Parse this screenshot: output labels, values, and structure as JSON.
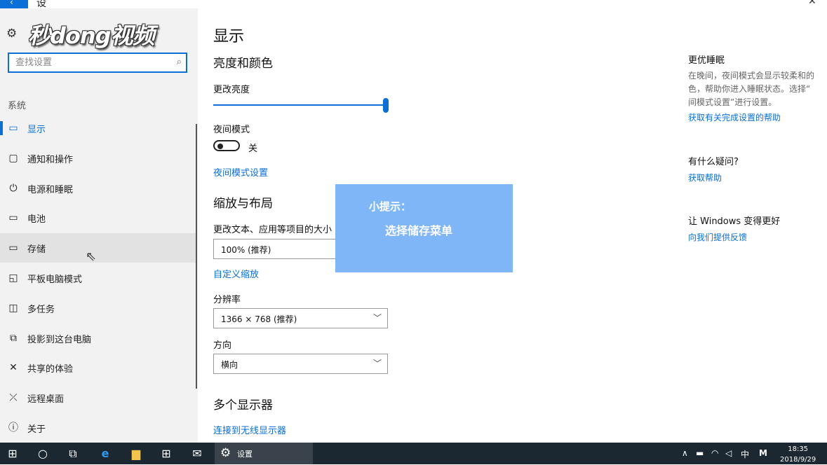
{
  "window": {
    "title_fragment": "设",
    "back_glyph": "‹",
    "close_glyph": "✕"
  },
  "sidebar": {
    "logo_text": "秒dong视频",
    "search_placeholder": "查找设置",
    "section_label": "系统",
    "items": [
      {
        "label": "显示",
        "icon": "monitor-icon",
        "glyph": "▭",
        "active": true
      },
      {
        "label": "通知和操作",
        "icon": "notification-icon",
        "glyph": "▢"
      },
      {
        "label": "电源和睡眠",
        "icon": "power-icon",
        "glyph": "⏻"
      },
      {
        "label": "电池",
        "icon": "battery-icon",
        "glyph": "▭"
      },
      {
        "label": "存储",
        "icon": "storage-icon",
        "glyph": "▭",
        "hover": true
      },
      {
        "label": "平板电脑模式",
        "icon": "tablet-icon",
        "glyph": "◱"
      },
      {
        "label": "多任务",
        "icon": "multitask-icon",
        "glyph": "◫"
      },
      {
        "label": "投影到这台电脑",
        "icon": "project-icon",
        "glyph": "⧉"
      },
      {
        "label": "共享的体验",
        "icon": "shared-icon",
        "glyph": "✕"
      },
      {
        "label": "远程桌面",
        "icon": "remote-icon",
        "glyph": "⤫"
      },
      {
        "label": "关于",
        "icon": "info-icon",
        "glyph": "ⓘ"
      }
    ]
  },
  "main": {
    "title": "显示",
    "brightness_section": "亮度和颜色",
    "brightness_label": "更改亮度",
    "brightness_value": 1.0,
    "night_mode_label": "夜间模式",
    "night_mode_state": "关",
    "night_mode_link": "夜间模式设置",
    "scale_section": "缩放与布局",
    "scale_label": "更改文本、应用等项目的大小",
    "scale_value": "100% (推荐)",
    "custom_scale_link": "自定义缩放",
    "resolution_label": "分辨率",
    "resolution_value": "1366 × 768 (推荐)",
    "orientation_label": "方向",
    "orientation_value": "横向",
    "multi_display_section": "多个显示器",
    "wireless_link": "连接到无线显示器"
  },
  "tip": {
    "line1": "小提示：",
    "line2": "选择储存菜单"
  },
  "right": {
    "sleep_title": "更优睡眠",
    "sleep_text": [
      "在晚间，夜间模式会显示较柔和的",
      "色，帮助你进入睡眠状态。选择“",
      "间模式设置”进行设置。"
    ],
    "sleep_link": "获取有关完成设置的帮助",
    "question_title": "有什么疑问?",
    "help_link": "获取帮助",
    "feedback_title": "让 Windows 变得更好",
    "feedback_link": "向我们提供反馈"
  },
  "taskbar": {
    "settings_label": "设置",
    "tray_ime": "中",
    "tray_m": "M",
    "time": "18:35",
    "date": "2018/9/29"
  },
  "colors": {
    "accent": "#0a6fd6",
    "tip_bg": "#7fb6f8",
    "taskbar": "#1b2731"
  }
}
